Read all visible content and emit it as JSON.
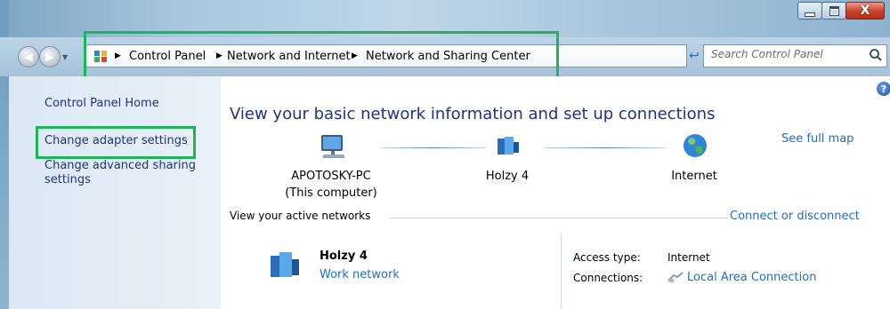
{
  "window": {
    "caption_buttons": {
      "minimize_icon": "minimize-icon",
      "maximize_icon": "maximize-icon",
      "close_glyph": "X"
    }
  },
  "address_bar": {
    "breadcrumbs": [
      "Control Panel",
      "Network and Internet",
      "Network and Sharing Center"
    ],
    "search_placeholder": "Search Control Panel"
  },
  "sidebar": {
    "items": [
      {
        "label": "Control Panel Home"
      },
      {
        "label": "Change adapter settings"
      },
      {
        "label": "Change advanced sharing settings"
      }
    ]
  },
  "main": {
    "title": "View your basic network information and set up connections",
    "see_full_map": "See full map",
    "map": {
      "computer_name": "APOTOSKY-PC",
      "computer_sub": "(This computer)",
      "network_name": "Holzy  4",
      "internet_label": "Internet"
    },
    "active_networks_label": "View your active networks",
    "connect_link": "Connect or disconnect",
    "network": {
      "name": "Holzy  4",
      "type": "Work network",
      "access_type_label": "Access type:",
      "access_type_value": "Internet",
      "connections_label": "Connections:",
      "connection_name": "Local Area Connection"
    }
  },
  "colors": {
    "link": "#1e6ec8",
    "sidebar_link": "#1e3287",
    "highlight": "#1fb45a"
  }
}
